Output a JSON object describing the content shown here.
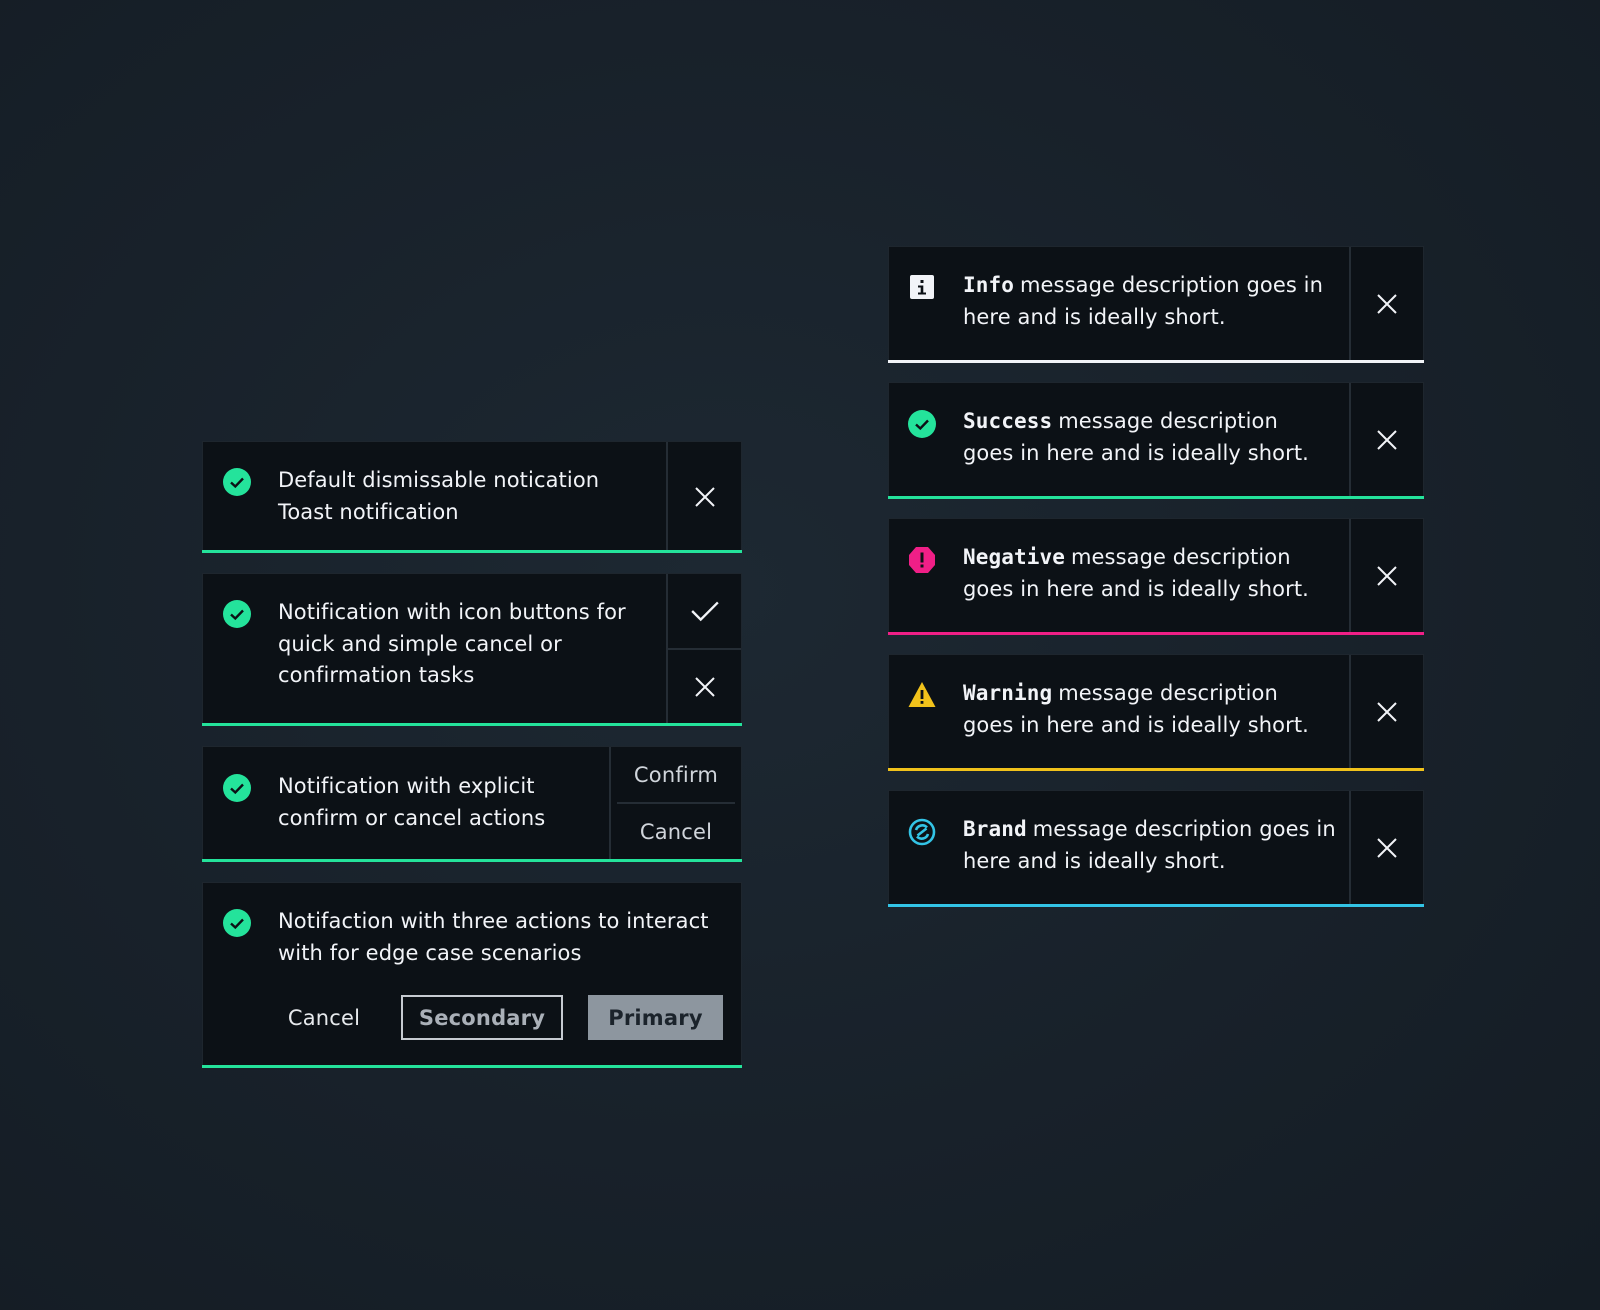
{
  "colors": {
    "success": "#24e39b",
    "info": "#f2f4f8",
    "negative": "#f01f87",
    "warning": "#f1c21b",
    "brand": "#33c4e6"
  },
  "left": {
    "toasts": [
      {
        "icon": "check-circle-icon",
        "line1": "Default dismissable notication",
        "line2": "Toast notification",
        "close_icon": "close-icon"
      },
      {
        "icon": "check-circle-icon",
        "line1": "Notification with icon buttons for",
        "line2": "quick and simple cancel or",
        "line3": "confirmation tasks",
        "confirm_icon": "checkmark-icon",
        "cancel_icon": "close-icon"
      },
      {
        "icon": "check-circle-icon",
        "line1": "Notification with explicit",
        "line2": "confirm or cancel actions",
        "confirm_label": "Confirm",
        "cancel_label": "Cancel"
      },
      {
        "icon": "check-circle-icon",
        "line1": "Notifaction with three actions to interact",
        "line2": "with for edge case scenarios",
        "cancel_label": "Cancel",
        "secondary_label": "Secondary",
        "primary_label": "Primary"
      }
    ]
  },
  "right": {
    "toasts": [
      {
        "kind": "Info",
        "icon": "info-square-icon",
        "line1": "message description goes in",
        "line2": "here and is ideally short."
      },
      {
        "kind": "Success",
        "icon": "check-circle-icon",
        "line1": "message description",
        "line2": "goes in here and is ideally short."
      },
      {
        "kind": "Negative",
        "icon": "error-octagon-icon",
        "line1": "message description",
        "line2": "goes in here and is ideally short."
      },
      {
        "kind": "Warning",
        "icon": "warning-triangle-icon",
        "line1": "message description",
        "line2": "goes in here and is ideally short."
      },
      {
        "kind": "Brand",
        "icon": "brand-circle-icon",
        "line1": "message description goes in",
        "line2": "here and is ideally short."
      }
    ]
  }
}
